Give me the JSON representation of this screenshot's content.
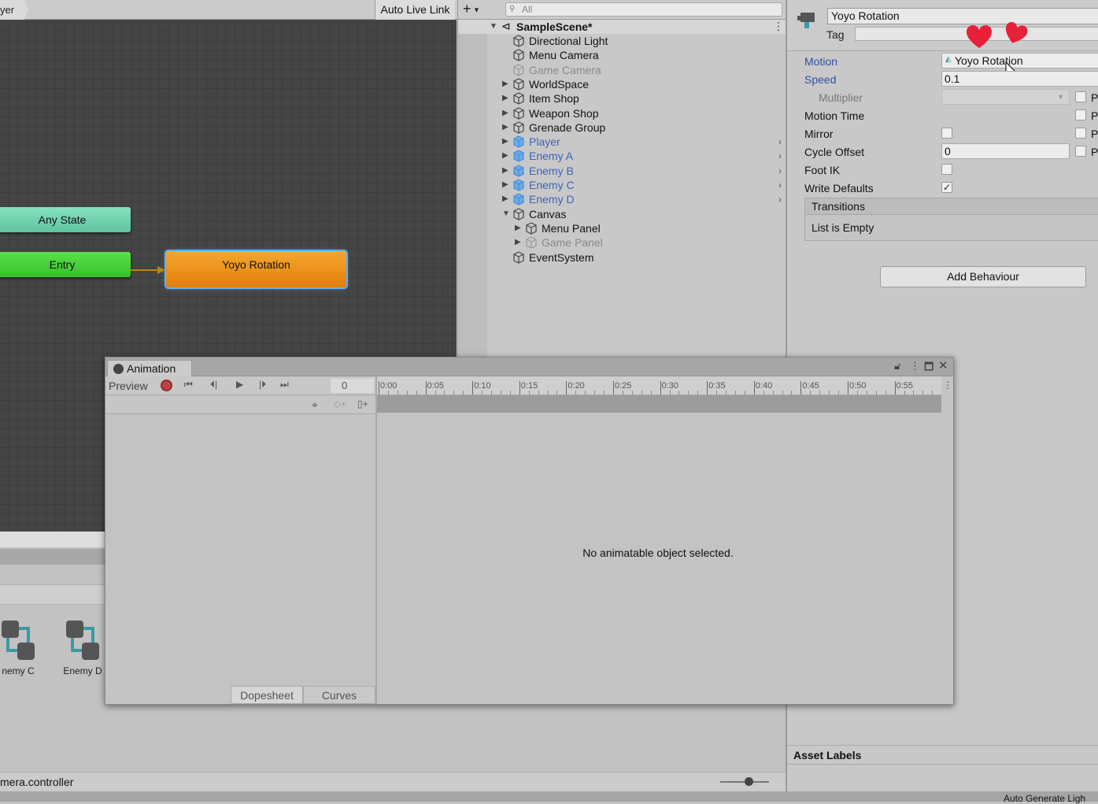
{
  "animator": {
    "breadcrumb": "yer",
    "auto_live_link": "Auto Live Link",
    "nodes": {
      "any_state": "Any State",
      "entry": "Entry",
      "state": "Yoyo Rotation"
    },
    "assets": [
      {
        "label": "nemy C"
      },
      {
        "label": "Enemy D"
      }
    ],
    "footer_path": "mera.controller"
  },
  "hierarchy": {
    "search_placeholder": "All",
    "scene": "SampleScene*",
    "items": [
      {
        "label": "Directional Light",
        "style": "normal"
      },
      {
        "label": "Menu Camera",
        "style": "normal"
      },
      {
        "label": "Game Camera",
        "style": "dim"
      },
      {
        "label": "WorldSpace",
        "style": "normal"
      },
      {
        "label": "Item Shop",
        "style": "normal"
      },
      {
        "label": "Weapon Shop",
        "style": "normal"
      },
      {
        "label": "Grenade Group",
        "style": "normal"
      },
      {
        "label": "Player",
        "style": "prefab"
      },
      {
        "label": "Enemy A",
        "style": "prefab"
      },
      {
        "label": "Enemy B",
        "style": "prefab"
      },
      {
        "label": "Enemy C",
        "style": "prefab"
      },
      {
        "label": "Enemy D",
        "style": "prefab"
      },
      {
        "label": "Canvas",
        "style": "normal"
      },
      {
        "label": "Menu Panel",
        "style": "normal"
      },
      {
        "label": "Game Panel",
        "style": "dim"
      },
      {
        "label": "EventSystem",
        "style": "normal"
      }
    ]
  },
  "inspector": {
    "name": "Yoyo Rotation",
    "tag_label": "Tag",
    "props": {
      "motion_label": "Motion",
      "motion_value": "Yoyo Rotation",
      "speed_label": "Speed",
      "speed_value": "0.1",
      "multiplier_label": "Multiplier",
      "motion_time_label": "Motion Time",
      "mirror_label": "Mirror",
      "cycle_offset_label": "Cycle Offset",
      "cycle_offset_value": "0",
      "foot_ik_label": "Foot IK",
      "write_defaults_label": "Write Defaults",
      "pa": "Pa"
    },
    "write_defaults_checked": true,
    "transitions_label": "Transitions",
    "transitions_empty": "List is Empty",
    "add_behaviour": "Add Behaviour",
    "asset_labels": "Asset Labels",
    "auto_generate": "Auto Generate Ligh"
  },
  "animation_window": {
    "tab": "Animation",
    "preview": "Preview",
    "frame": "0",
    "ticks": [
      "0:00",
      "0:05",
      "0:10",
      "0:15",
      "0:20",
      "0:25",
      "0:30",
      "0:35",
      "0:40",
      "0:45",
      "0:50",
      "0:55"
    ],
    "no_object": "No animatable object selected.",
    "dopesheet": "Dopesheet",
    "curves": "Curves"
  }
}
